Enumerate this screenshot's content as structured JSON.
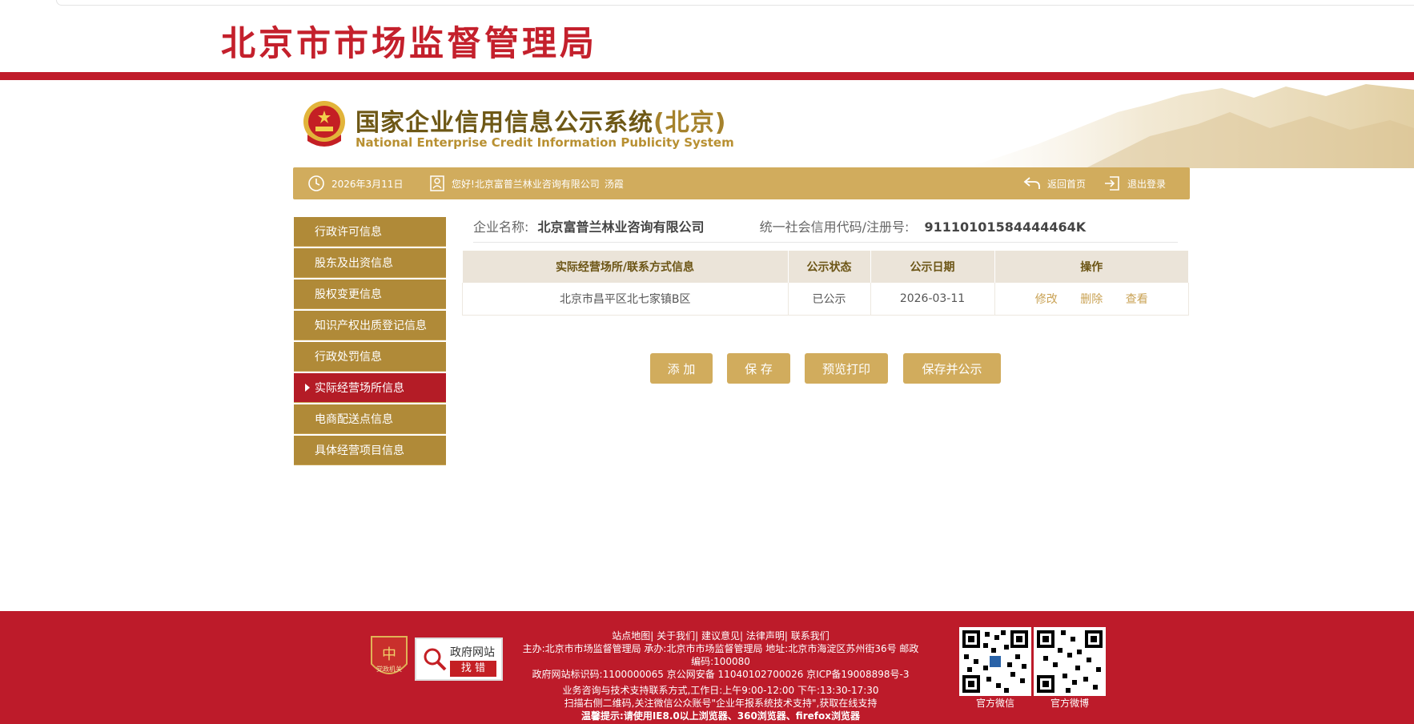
{
  "header": {
    "org_title": "北京市市场监督管理局",
    "system_title": "国家企业信用信息公示系统",
    "system_title_region": "(北京)",
    "system_subtitle": "National Enterprise Credit Information Publicity System"
  },
  "infobar": {
    "date": "2026年3月11日",
    "greeting": "您好!北京富普兰林业咨询有限公司",
    "user": "汤霞",
    "home_label": "返回首页",
    "logout_label": "退出登录"
  },
  "sidebar": {
    "items": [
      {
        "label": "行政许可信息"
      },
      {
        "label": "股东及出资信息"
      },
      {
        "label": "股权变更信息"
      },
      {
        "label": "知识产权出质登记信息"
      },
      {
        "label": "行政处罚信息"
      },
      {
        "label": "实际经营场所信息"
      },
      {
        "label": "电商配送点信息"
      },
      {
        "label": "具体经营项目信息"
      }
    ],
    "active_index": 5
  },
  "company": {
    "name_label": "企业名称:",
    "name": "北京富普兰林业咨询有限公司",
    "code_label": "统一社会信用代码/注册号:",
    "code": "91110101584444464K"
  },
  "table": {
    "headers": [
      "实际经营场所/联系方式信息",
      "公示状态",
      "公示日期",
      "操作"
    ],
    "rows": [
      {
        "address": "北京市昌平区北七家镇B区",
        "status": "已公示",
        "date": "2026-03-11",
        "ops": [
          "修改",
          "删除",
          "查看"
        ]
      }
    ]
  },
  "buttons": {
    "add": "添 加",
    "save": "保 存",
    "preview": "预览打印",
    "save_publish": "保存并公示"
  },
  "footer": {
    "links": "站点地图| 关于我们| 建议意见| 法律声明| 联系我们",
    "host_line": "主办:北京市市场监督管理局 承办:北京市市场监督管理局 地址:北京市海淀区苏州街36号 邮政",
    "postcode": "编码:100080",
    "ids": "政府网站标识码:1100000065     京公网安备 11040102700026     京ICP备19008898号-3",
    "hours": "业务咨询与技术支持联系方式,工作日:上午9:00-12:00 下午:13:30-17:30",
    "scan": "扫描右侧二维码,关注微信公众账号\"企业年报系统技术支持\",获取在线支持",
    "tip": "温馨提示:请使用IE8.0以上浏览器、360浏览器、firefox浏览器",
    "badge_text": "党政机关",
    "zfwz_top": "政府网站",
    "zfwz_bottom": "找 错",
    "qr_wechat_label": "官方微信",
    "qr_weibo_label": "官方微博"
  },
  "colors": {
    "brand_red": "#c01b2a",
    "gold": "#d1ac5d",
    "sidebar_gold": "#b08a38",
    "active_red": "#b41c26"
  }
}
